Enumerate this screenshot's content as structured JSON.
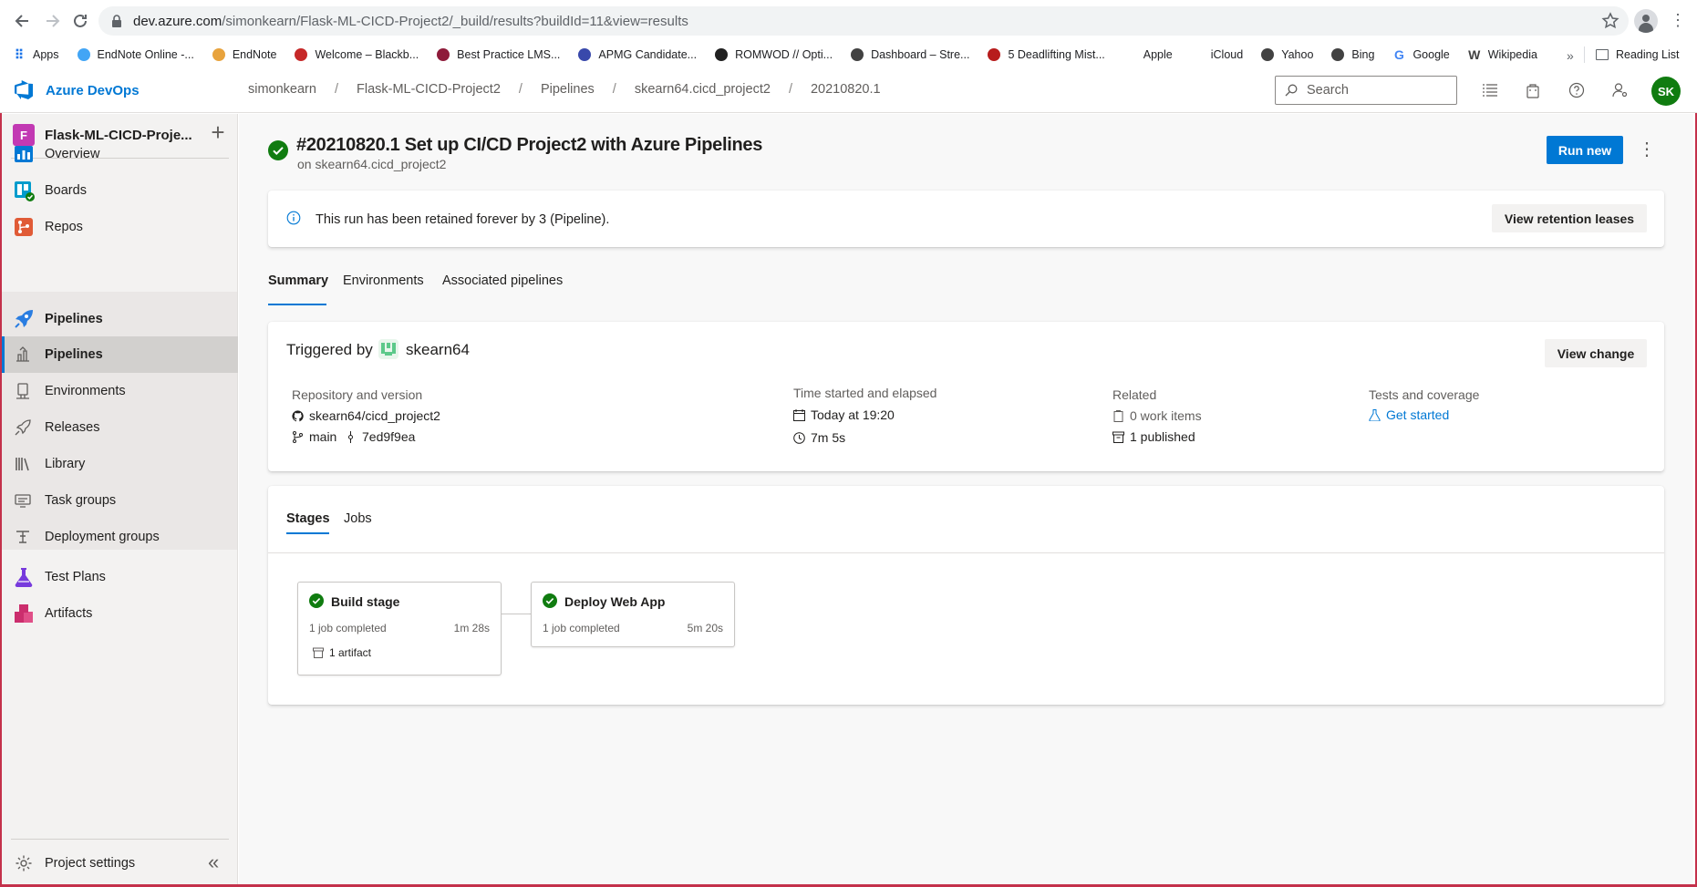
{
  "browser": {
    "url_host": "dev.azure.com",
    "url_path": "/simonkearn/Flask-ML-CICD-Project2/_build/results?buildId=11&view=results",
    "bookmarks": [
      {
        "label": "Apps",
        "icon": "apps-grid-icon",
        "color": "#1a73e8"
      },
      {
        "label": "EndNote Online -...",
        "icon": "cloud-icon",
        "color": "#42a5f5"
      },
      {
        "label": "EndNote",
        "icon": "endnote-icon",
        "color": "#e8a33d"
      },
      {
        "label": "Welcome – Blackb...",
        "icon": "blackboard-icon",
        "color": "#c62828"
      },
      {
        "label": "Best Practice LMS...",
        "icon": "bestpractice-icon",
        "color": "#8e1b3a"
      },
      {
        "label": "APMG Candidate...",
        "icon": "apmg-icon",
        "color": "#3949ab"
      },
      {
        "label": "ROMWOD // Opti...",
        "icon": "romwod-icon",
        "color": "#212121"
      },
      {
        "label": "Dashboard – Stre...",
        "icon": "globe-icon",
        "color": "#424242"
      },
      {
        "label": "5 Deadlifting Mist...",
        "icon": "deadlift-icon",
        "color": "#b71c1c"
      },
      {
        "label": "Apple",
        "icon": "apple-icon",
        "color": "#424242"
      },
      {
        "label": "iCloud",
        "icon": "apple-icon",
        "color": "#424242"
      },
      {
        "label": "Yahoo",
        "icon": "globe-icon",
        "color": "#424242"
      },
      {
        "label": "Bing",
        "icon": "globe-icon",
        "color": "#424242"
      },
      {
        "label": "Google",
        "icon": "google-icon",
        "color": "#4285f4"
      },
      {
        "label": "Wikipedia",
        "icon": "wikipedia-icon",
        "color": "#424242"
      }
    ],
    "more": "»",
    "reading_list": "Reading List"
  },
  "topbar": {
    "brand": "Azure DevOps",
    "breadcrumbs": [
      "simonkearn",
      "Flask-ML-CICD-Project2",
      "Pipelines",
      "skearn64.cicd_project2",
      "20210820.1"
    ],
    "search_placeholder": "Search",
    "avatar_initials": "SK"
  },
  "sidebar": {
    "project_initial": "F",
    "project_name": "Flask-ML-CICD-Proje...",
    "items": [
      {
        "label": "Overview",
        "icon": "overview-icon"
      },
      {
        "label": "Boards",
        "icon": "boards-icon"
      },
      {
        "label": "Repos",
        "icon": "repos-icon"
      },
      {
        "label": "Pipelines",
        "icon": "pipelines-icon"
      }
    ],
    "sub_items": [
      {
        "label": "Pipelines",
        "icon": "pipelines-sub-icon"
      },
      {
        "label": "Environments",
        "icon": "environments-icon"
      },
      {
        "label": "Releases",
        "icon": "releases-icon"
      },
      {
        "label": "Library",
        "icon": "library-icon"
      },
      {
        "label": "Task groups",
        "icon": "task-groups-icon"
      },
      {
        "label": "Deployment groups",
        "icon": "deployment-groups-icon"
      }
    ],
    "bottom_items": [
      {
        "label": "Test Plans",
        "icon": "test-plans-icon"
      },
      {
        "label": "Artifacts",
        "icon": "artifacts-icon"
      }
    ],
    "settings": "Project settings",
    "collapse_icon": "«"
  },
  "run": {
    "title": "#20210820.1 Set up CI/CD Project2 with Azure Pipelines",
    "subtitle": "on skearn64.cicd_project2",
    "run_new": "Run new",
    "status_color": "#107c10"
  },
  "banner": {
    "text": "This run has been retained forever by 3 (Pipeline).",
    "button": "View retention leases"
  },
  "tabs": [
    "Summary",
    "Environments",
    "Associated pipelines"
  ],
  "summary": {
    "triggered_label": "Triggered by",
    "triggered_user": "skearn64",
    "view_change": "View change",
    "repo_head": "Repository and version",
    "repo": "skearn64/cicd_project2",
    "branch": "main",
    "commit": "7ed9f9ea",
    "time_head": "Time started and elapsed",
    "started": "Today at 19:20",
    "elapsed": "7m 5s",
    "related_head": "Related",
    "work_items": "0 work items",
    "published": "1 published",
    "tests_head": "Tests and coverage",
    "get_started": "Get started"
  },
  "stages_tabs": [
    "Stages",
    "Jobs"
  ],
  "stages": [
    {
      "name": "Build stage",
      "jobs": "1 job completed",
      "duration": "1m 28s",
      "artifact": "1 artifact"
    },
    {
      "name": "Deploy Web App",
      "jobs": "1 job completed",
      "duration": "5m 20s"
    }
  ]
}
